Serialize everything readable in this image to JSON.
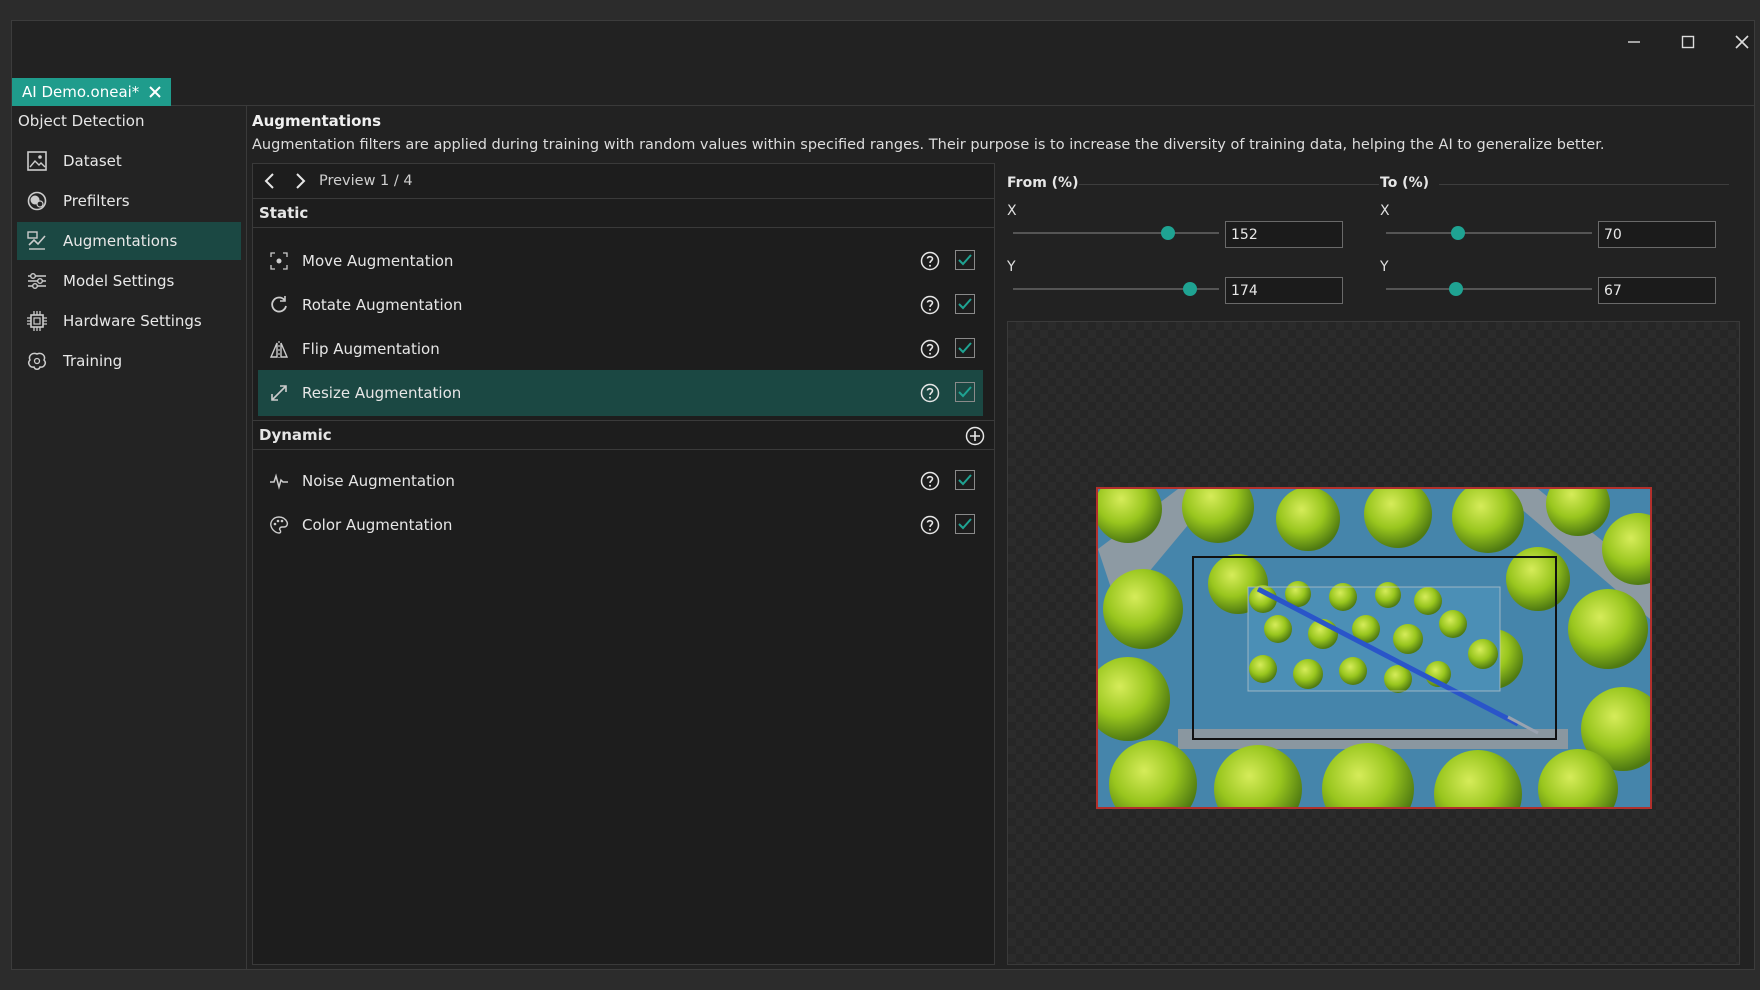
{
  "window": {
    "controls": {
      "minimize": "minimize",
      "maximize": "maximize",
      "close": "close"
    }
  },
  "tab": {
    "label": "AI Demo.oneai*"
  },
  "sidebar": {
    "title": "Object Detection",
    "items": [
      {
        "label": "Dataset",
        "icon": "image-icon"
      },
      {
        "label": "Prefilters",
        "icon": "prefilter-icon"
      },
      {
        "label": "Augmentations",
        "icon": "augment-icon",
        "active": true
      },
      {
        "label": "Model Settings",
        "icon": "sliders-icon"
      },
      {
        "label": "Hardware Settings",
        "icon": "chip-icon"
      },
      {
        "label": "Training",
        "icon": "brain-icon"
      }
    ]
  },
  "main": {
    "title": "Augmentations",
    "description": "Augmentation filters are applied during training with random values within specified ranges. Their purpose is to increase the diversity of training data, helping the AI to generalize better.",
    "preview_label": "Preview 1 / 4",
    "static_header": "Static",
    "dynamic_header": "Dynamic",
    "static_items": [
      {
        "label": "Move Augmentation",
        "checked": true
      },
      {
        "label": "Rotate Augmentation",
        "checked": true
      },
      {
        "label": "Flip Augmentation",
        "checked": true
      },
      {
        "label": "Resize Augmentation",
        "checked": true,
        "selected": true
      }
    ],
    "dynamic_items": [
      {
        "label": "Noise Augmentation",
        "checked": true
      },
      {
        "label": "Color Augmentation",
        "checked": true
      }
    ]
  },
  "settings": {
    "from_title": "From (%)",
    "to_title": "To (%)",
    "x_label": "X",
    "y_label": "Y",
    "from_x": "152",
    "from_y": "174",
    "to_x": "70",
    "to_y": "67",
    "slider_levels": {
      "from_x": 0.75,
      "from_y": 0.86,
      "to_x": 0.35,
      "to_y": 0.34
    }
  },
  "colors": {
    "accent": "#1fa392",
    "selected_bg": "#1b4843",
    "bbox": "#b3302c"
  }
}
